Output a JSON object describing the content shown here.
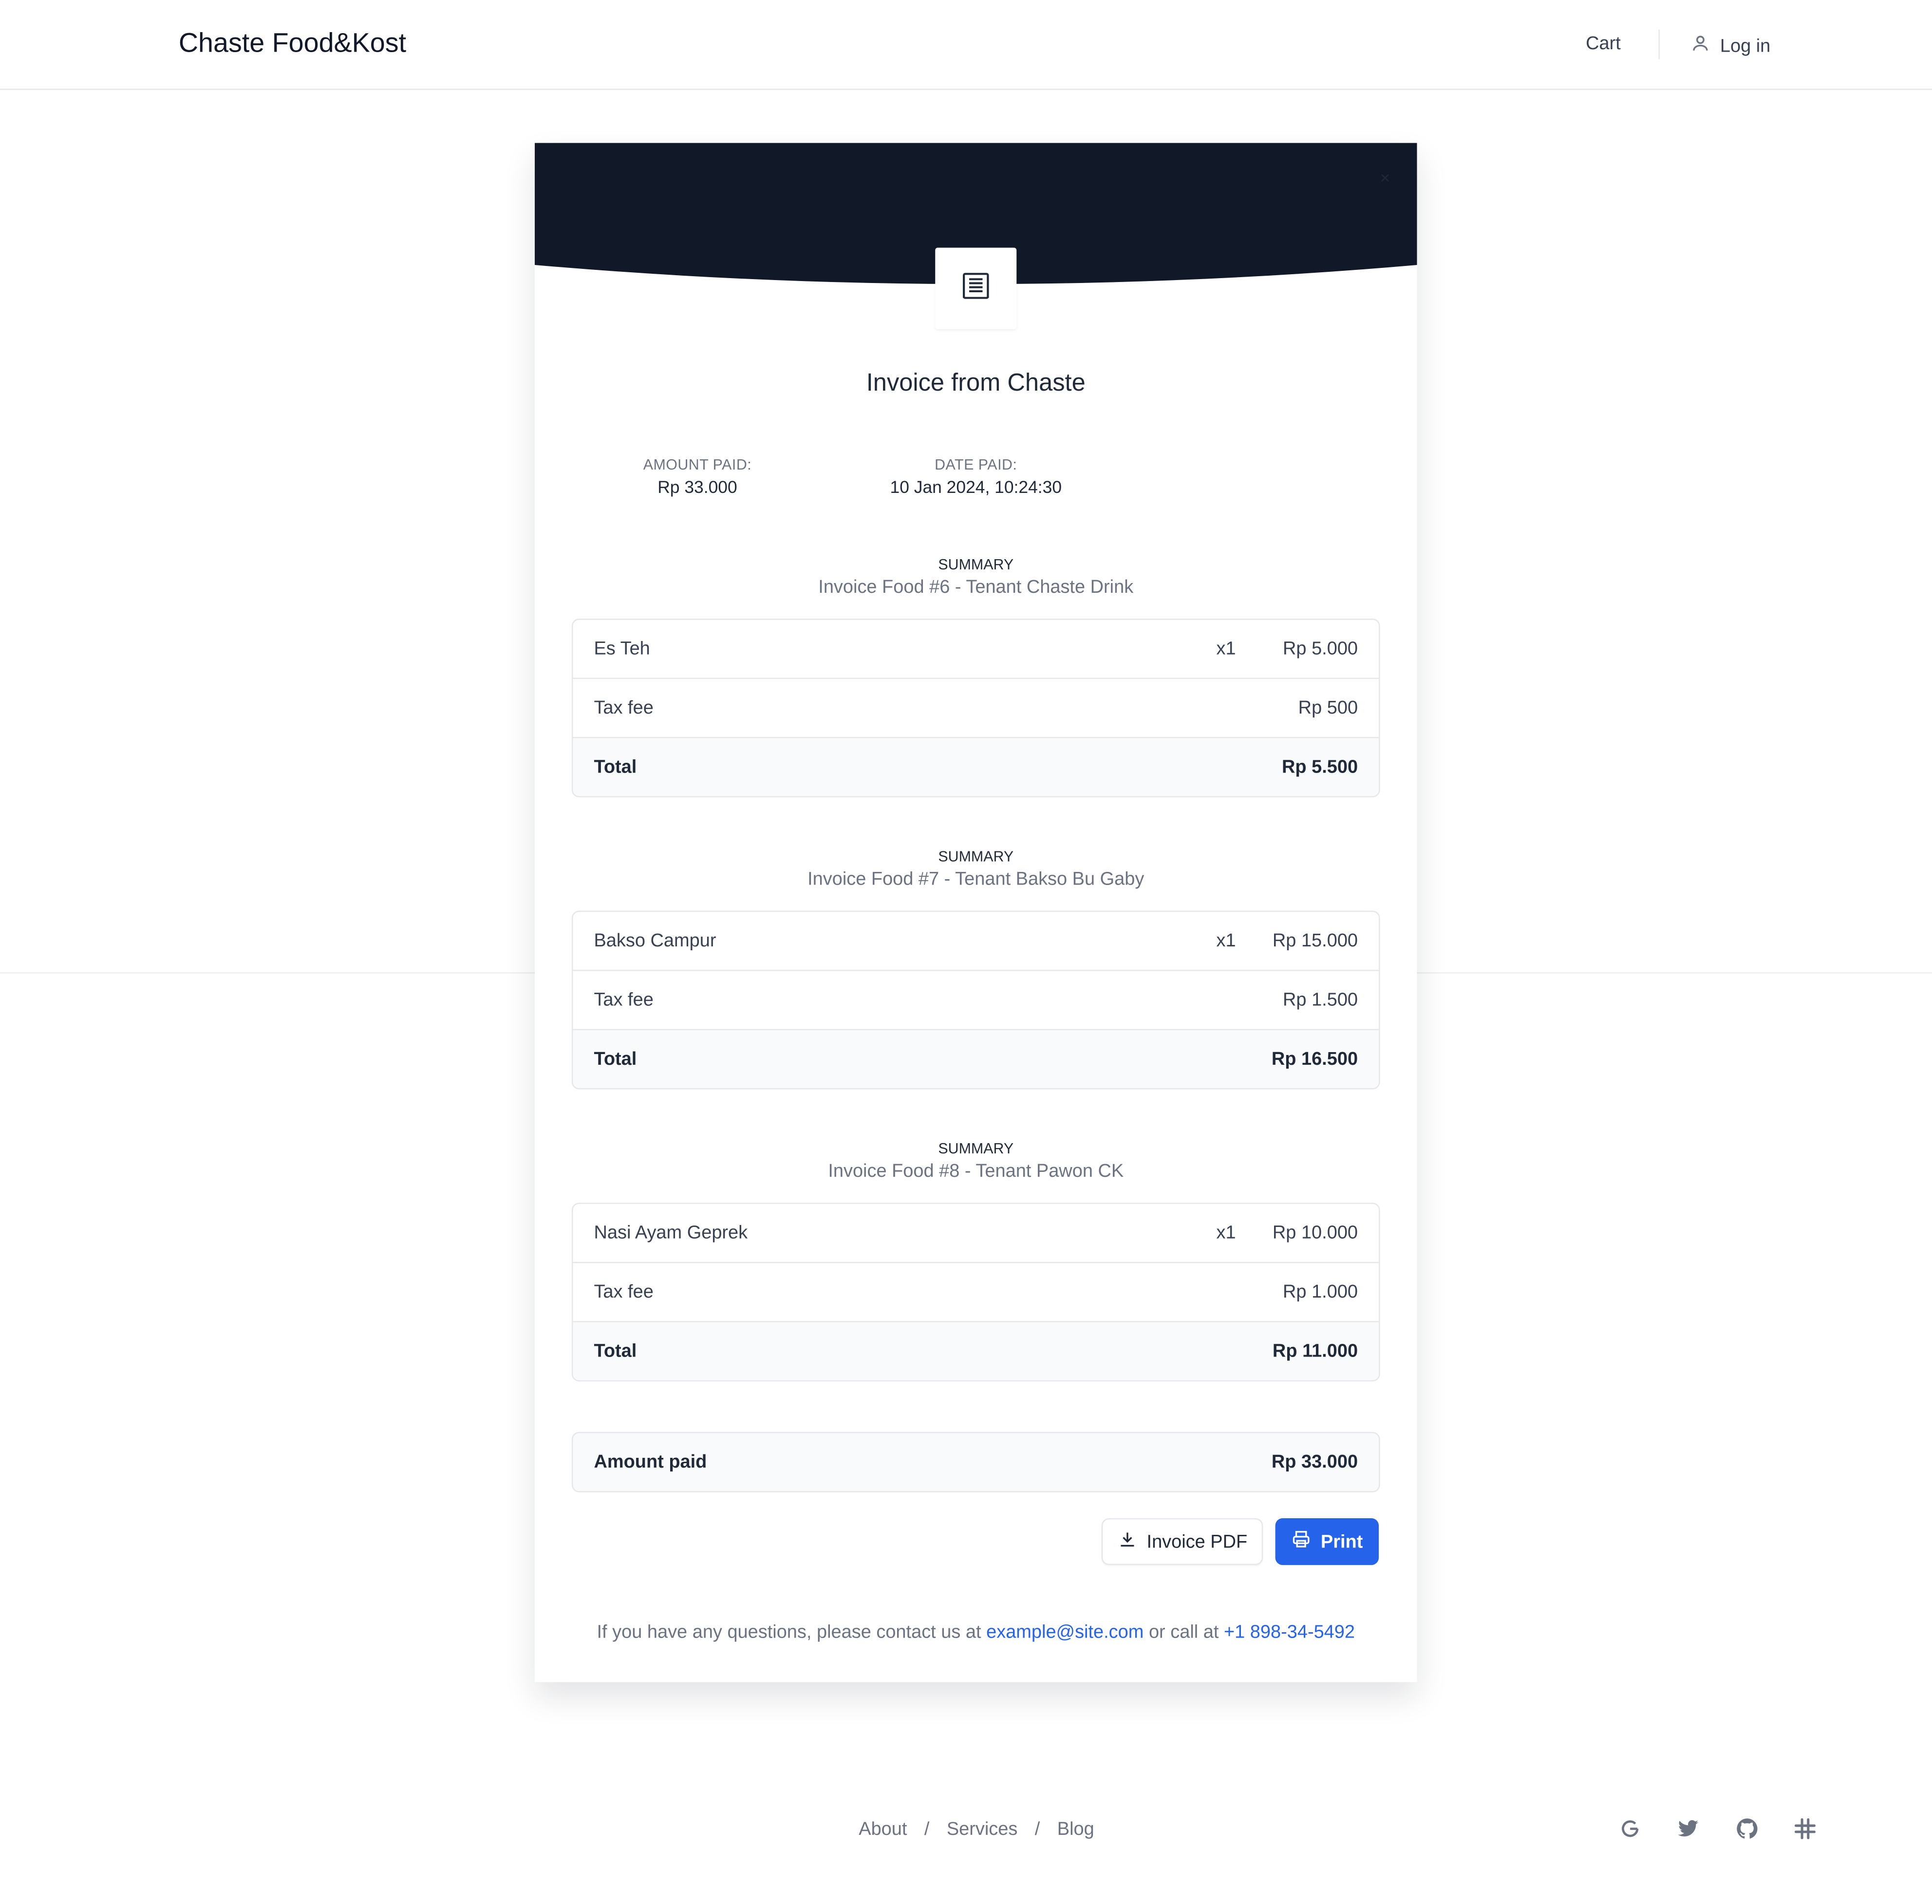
{
  "header": {
    "brand": "Chaste Food&Kost",
    "cart_label": "Cart",
    "login_label": "Log in"
  },
  "invoice": {
    "close_glyph": "×",
    "title": "Invoice from Chaste",
    "amount_paid_label": "AMOUNT PAID:",
    "amount_paid_value": "Rp 33.000",
    "date_paid_label": "DATE PAID:",
    "date_paid_value": "10 Jan 2024, 10:24:30",
    "summaries": [
      {
        "heading": "SUMMARY",
        "title": "Invoice Food #6 - Tenant Chaste Drink",
        "item": {
          "name": "Es Teh",
          "qty": "x1",
          "amount": "Rp 5.000"
        },
        "tax": {
          "name": "Tax fee",
          "amount": "Rp 500"
        },
        "total": {
          "name": "Total",
          "amount": "Rp 5.500"
        }
      },
      {
        "heading": "SUMMARY",
        "title": "Invoice Food #7 - Tenant Bakso Bu Gaby",
        "item": {
          "name": "Bakso Campur",
          "qty": "x1",
          "amount": "Rp 15.000"
        },
        "tax": {
          "name": "Tax fee",
          "amount": "Rp 1.500"
        },
        "total": {
          "name": "Total",
          "amount": "Rp 16.500"
        }
      },
      {
        "heading": "SUMMARY",
        "title": "Invoice Food #8 - Tenant Pawon CK",
        "item": {
          "name": "Nasi Ayam Geprek",
          "qty": "x1",
          "amount": "Rp 10.000"
        },
        "tax": {
          "name": "Tax fee",
          "amount": "Rp 1.000"
        },
        "total": {
          "name": "Total",
          "amount": "Rp 11.000"
        }
      }
    ],
    "amount_paid_row": {
      "name": "Amount paid",
      "amount": "Rp 33.000"
    },
    "buttons": {
      "pdf": "Invoice PDF",
      "print": "Print"
    },
    "contact": {
      "prefix": "If you have any questions, please contact us at",
      "email": "example@site.com",
      "middle": "or call at",
      "phone": "+1 898-34-5492"
    }
  },
  "footer": {
    "links": [
      "About",
      "Services",
      "Blog"
    ],
    "separator": "/",
    "social_icons": [
      "google-icon",
      "twitter-icon",
      "github-icon",
      "slack-icon"
    ]
  },
  "colors": {
    "banner": "#111827",
    "primary": "#2563eb"
  }
}
